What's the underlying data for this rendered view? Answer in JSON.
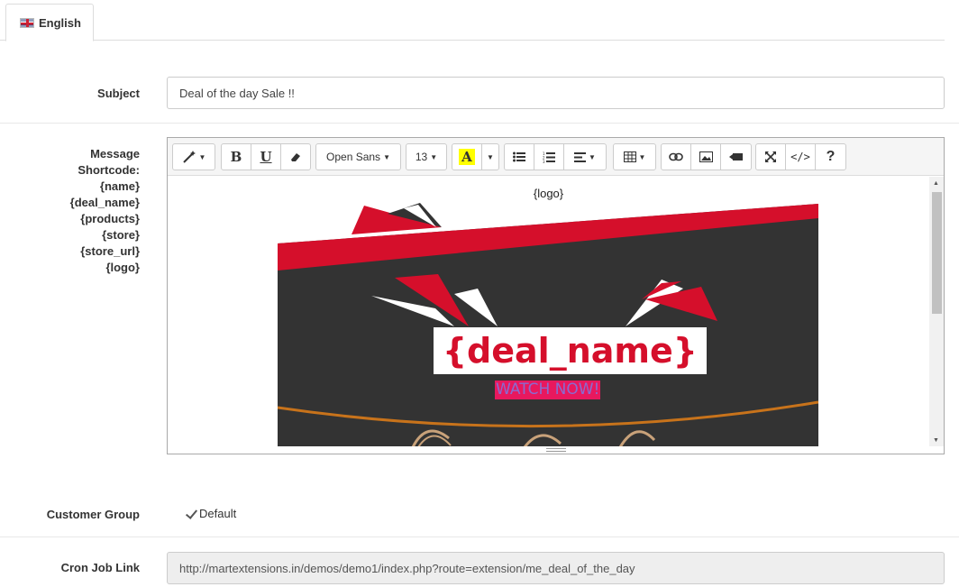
{
  "tabs": [
    {
      "label": "English",
      "flag": "uk-flag-icon"
    }
  ],
  "subject": {
    "label": "Subject",
    "value": "Deal of the day Sale !!"
  },
  "message": {
    "label": "Message",
    "shortcode_label": "Shortcode:",
    "shortcodes": [
      "{name}",
      "{deal_name}",
      "{products}",
      "{store}",
      "{store_url}",
      "{logo}"
    ]
  },
  "editor": {
    "font_family": "Open Sans",
    "font_size": "13",
    "content": {
      "logo_placeholder": "{logo}",
      "deal_name": "{deal_name}",
      "cta": "WATCH NOW!"
    }
  },
  "customer_group": {
    "label": "Customer Group",
    "option": "Default",
    "checked": true
  },
  "cron": {
    "label": "Cron Job Link",
    "value": "http://martextensions.in/demos/demo1/index.php?route=extension/me_deal_of_the_day"
  },
  "colors": {
    "brand_red": "#d50f2b",
    "banner_dark": "#333333",
    "cta_bg": "#e8185e"
  }
}
